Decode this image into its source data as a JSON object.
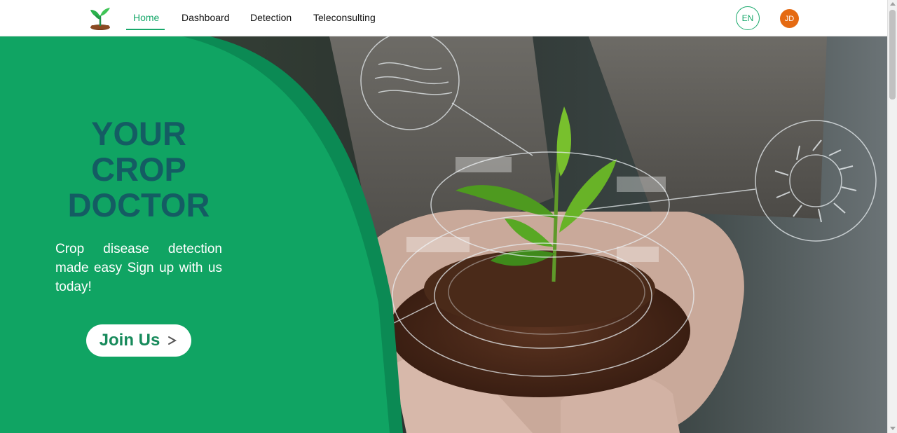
{
  "nav": {
    "links": [
      {
        "label": "Home",
        "active": true
      },
      {
        "label": "Dashboard"
      },
      {
        "label": "Detection"
      },
      {
        "label": "Teleconsulting"
      }
    ],
    "language": "EN",
    "avatar_initials": "JD"
  },
  "hero": {
    "headline": [
      "YOUR",
      "CROP",
      "DOCTOR"
    ],
    "subtitle": "Crop disease detection made easy Sign up with us today!",
    "cta_label": "Join Us"
  },
  "colors": {
    "brand_green": "#18a86b",
    "hero_green": "#10a463",
    "headline_teal": "#145c63",
    "avatar_orange": "#e56a12"
  },
  "icons": {
    "logo": "seedling-logo-icon",
    "cta_arrow": "arrow-right-icon"
  }
}
